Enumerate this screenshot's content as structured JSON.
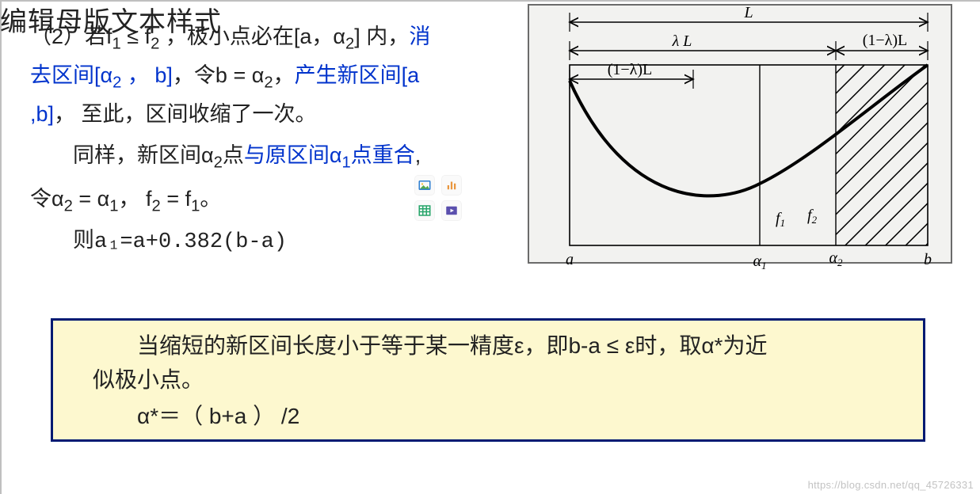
{
  "title": "编辑母版文本样式",
  "body": {
    "prefix": "（2）若f",
    "cond": " ≤ f",
    "after_cond": " ，极小点必在[a，α",
    "after_a2": "] 内，",
    "elim": "消去区间",
    "elim_interval_open": "[α",
    "elim_interval_mid": " ， b]",
    "let": "，令b = α",
    "let_after": "，",
    "newint": "产生新区间[a ,b]",
    "tail": "， 至此，区间收缩了一次。",
    "same_prefix": "同样，新区间α",
    "same_mid": "点",
    "coincide": "与原区间α",
    "coincide_tail": "点重合",
    "let2_prefix": "令α",
    "let2_eq": " =  α",
    "let2_comma": "，  f",
    "let2_eq2": " =  f",
    "let2_end": "。",
    "then": "则a₁=a+0.382(b-a)"
  },
  "diagram": {
    "L": "L",
    "lambdaL": "λ L",
    "oneMinusLambdaL_top": "(1−λ)L",
    "oneMinusLambdaL_inner": "(1−λ)L",
    "f1": "f",
    "f2": "f",
    "a": "a",
    "alpha1": "α",
    "alpha2": "α",
    "b": "b"
  },
  "note": {
    "line1a": "当缩短的新区间长度小于等于某一精度ε，即b-a ≤ ε时，取α*为近",
    "line1b": "似极小点。",
    "line2": "α*＝（ b+a ） /2"
  },
  "watermark": "https://blog.csdn.net/qq_45726331"
}
